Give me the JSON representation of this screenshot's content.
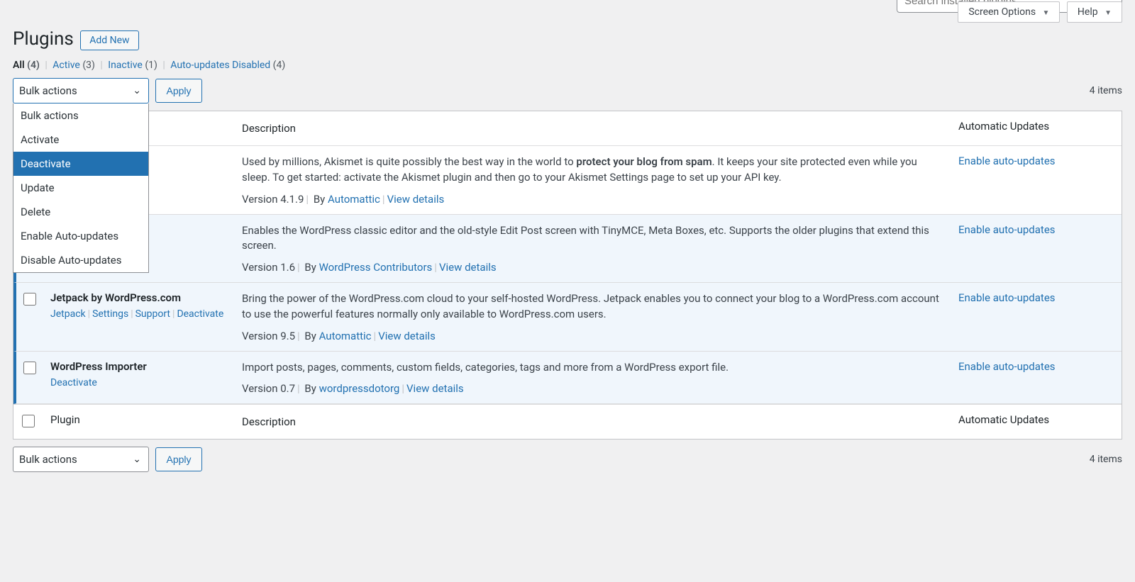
{
  "topButtons": {
    "screenOptions": "Screen Options",
    "help": "Help"
  },
  "page": {
    "title": "Plugins",
    "addNew": "Add New"
  },
  "filters": {
    "all": {
      "label": "All",
      "count": "(4)"
    },
    "active": {
      "label": "Active",
      "count": "(3)"
    },
    "inactive": {
      "label": "Inactive",
      "count": "(1)"
    },
    "autoDisabled": {
      "label": "Auto-updates Disabled",
      "count": "(4)"
    }
  },
  "search": {
    "placeholder": "Search installed plugins..."
  },
  "bulk": {
    "label": "Bulk actions",
    "apply": "Apply",
    "options": [
      "Bulk actions",
      "Activate",
      "Deactivate",
      "Update",
      "Delete",
      "Enable Auto-updates",
      "Disable Auto-updates"
    ],
    "selected": "Deactivate"
  },
  "itemsCount": "4 items",
  "columns": {
    "plugin": "Plugin",
    "description": "Description",
    "autoUpdates": "Automatic Updates"
  },
  "rows": [
    {
      "active": false,
      "descPre": "Used by millions, Akismet is quite possibly the best way in the world to ",
      "descBold": "protect your blog from spam",
      "descPost": ". It keeps your site protected even while you sleep. To get started: activate the Akismet plugin and then go to your Akismet Settings page to set up your API key.",
      "version": "Version 4.1.9",
      "by": "By",
      "author": "Automattic",
      "viewDetails": "View details",
      "autoUpdate": "Enable auto-updates"
    },
    {
      "active": true,
      "desc": "Enables the WordPress classic editor and the old-style Edit Post screen with TinyMCE, Meta Boxes, etc. Supports the older plugins that extend this screen.",
      "version": "Version 1.6",
      "by": "By",
      "author": "WordPress Contributors",
      "viewDetails": "View details",
      "autoUpdate": "Enable auto-updates"
    },
    {
      "active": true,
      "name": "Jetpack by WordPress.com",
      "actions": [
        "Jetpack",
        "Settings",
        "Support",
        "Deactivate"
      ],
      "desc": "Bring the power of the WordPress.com cloud to your self-hosted WordPress. Jetpack enables you to connect your blog to a WordPress.com account to use the powerful features normally only available to WordPress.com users.",
      "version": "Version 9.5",
      "by": "By",
      "author": "Automattic",
      "viewDetails": "View details",
      "autoUpdate": "Enable auto-updates"
    },
    {
      "active": true,
      "name": "WordPress Importer",
      "actions": [
        "Deactivate"
      ],
      "desc": "Import posts, pages, comments, custom fields, categories, tags and more from a WordPress export file.",
      "version": "Version 0.7",
      "by": "By",
      "author": "wordpressdotorg",
      "viewDetails": "View details",
      "autoUpdate": "Enable auto-updates"
    }
  ]
}
